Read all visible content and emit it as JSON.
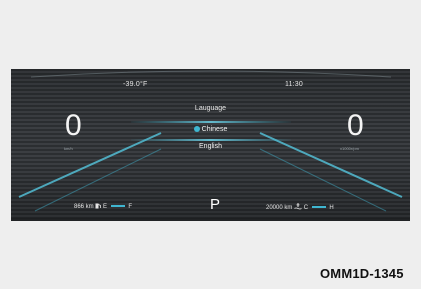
{
  "header": {
    "temperature": "-39.0°F",
    "time": "11:30"
  },
  "speedometer": {
    "value": "0",
    "unit": "km/h"
  },
  "tachometer": {
    "value": "0",
    "unit": "x1000r/pm"
  },
  "language_menu": {
    "title": "Lauguage",
    "options": [
      {
        "label": "Chinese",
        "selected": true
      },
      {
        "label": "English",
        "selected": false
      }
    ]
  },
  "fuel": {
    "range": "866 km",
    "low_mark": "E",
    "high_mark": "F",
    "icon": "fuel-pump-icon"
  },
  "coolant": {
    "odometer": "20000 km",
    "low_mark": "C",
    "high_mark": "H",
    "icon": "coolant-temperature-icon"
  },
  "gear": {
    "current": "P"
  },
  "caption": "OMM1D-1345",
  "colors": {
    "accent": "#3fb6d0",
    "panel_dark": "#2b2e31",
    "panel_light": "#3b3e42"
  }
}
